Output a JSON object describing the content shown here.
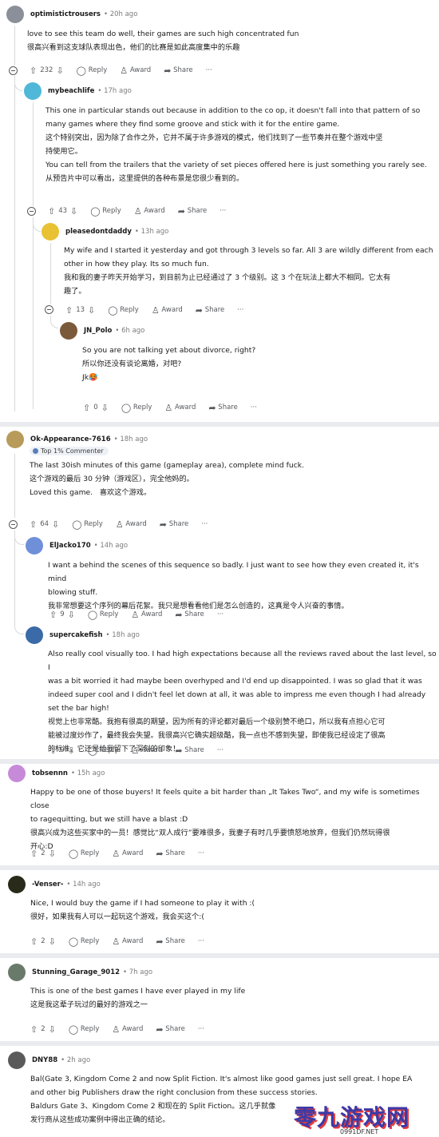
{
  "comments": [
    {
      "user": "optimistictrousers",
      "time": "20h ago",
      "lines": [
        "love to see this team do well, their games are such high concentrated fun",
        "很高兴看到这支球队表现出色，他们的比赛是如此高度集中的乐趣"
      ],
      "votes": "232",
      "avatar_color": "#8a8f99"
    },
    {
      "user": "mybeachlife",
      "time": "17h ago",
      "lines": [
        "This one in particular stands out because in addition to the co op, it doesn't fall into that pattern of so",
        "many games where they find some groove and stick with it for the entire game.",
        "这个特别突出，因为除了合作之外，它并不属于许多游戏的模式，他们找到了一些节奏并在整个游戏中坚",
        "持使用它。",
        "",
        "You can tell from the trailers that the variety of set pieces offered here is just something you rarely see.",
        "从预告片中可以看出，这里提供的各种布景是您很少看到的。"
      ],
      "votes": "43",
      "avatar_color": "#4fb8d8"
    },
    {
      "user": "pleasedontdaddy",
      "time": "13h ago",
      "lines": [
        "My wife and I started it yesterday and got through 3 levels so far. All 3 are wildly different from each",
        "other in how they play. Its so much fun.",
        "我和我的妻子昨天开始学习，到目前为止已经通过了 3 个级别。这 3 个在玩法上都大不相同。它太有",
        "趣了。"
      ],
      "votes": "13",
      "avatar_color": "#e8c233"
    },
    {
      "user": "JN_Polo",
      "time": "6h ago",
      "lines": [
        "So you are not talking yet about divorce, right?",
        "所以你还没有谈论离婚，对吧?",
        "",
        "Jk🥵"
      ],
      "votes": "0",
      "avatar_color": "#7a5a3a"
    },
    {
      "user": "Ok-Appearance-7616",
      "time": "18h ago",
      "badge": "Top 1% Commenter",
      "lines": [
        "The last 30ish minutes of this game (gameplay area), complete mind fuck.",
        "这个游戏的最后 30 分钟（游戏区），完全他妈的。",
        "",
        "Loved this game.   喜欢这个游戏。"
      ],
      "votes": "64",
      "avatar_color": "#b89a5a"
    },
    {
      "user": "ElJacko170",
      "time": "14h ago",
      "lines": [
        "I want a behind the scenes of this sequence so badly. I just want to see how they even created it, it's mind",
        "blowing stuff.",
        "我非常想要这个序列的幕后花絮。我只是想看看他们是怎么创造的，这真是令人兴奋的事情。"
      ],
      "votes": "9",
      "avatar_color": "#6f8fd8"
    },
    {
      "user": "supercakefish",
      "time": "18h ago",
      "lines": [
        "Also really cool visually too. I had high expectations because all the reviews raved about the last level, so I",
        "was a bit worried it had maybe been overhyped and I'd end up disappointed. I was so glad that it was",
        "indeed super cool and I didn't feel let down at all, it was able to impress me even though I had already",
        "set the bar high!",
        "视觉上也非常酷。我抱有很高的期望，因为所有的评论都对最后一个级别赞不绝口，所以我有点担心它可",
        "能被过度炒作了，最终我会失望。我很高兴它确实超级酷，我一点也不感到失望，即使我已经设定了很高",
        "的标准，它还是给我留下了深刻的印象！"
      ],
      "votes": "9",
      "avatar_color": "#3a6aa8"
    },
    {
      "user": "tobsennn",
      "time": "15h ago",
      "lines": [
        "Happy to be one of those buyers! It feels quite a bit harder than „It Takes Two“, and my wife is sometimes close",
        "to ragequitting, but we still have a blast :D",
        "很高兴成为这些买家中的一员！感觉比“双人成行”要难很多，我妻子有时几乎要愤怒地放弃，但我们仍然玩得很",
        "开心:D"
      ],
      "votes": "2",
      "avatar_color": "#c78ad8"
    },
    {
      "user": "-Venser-",
      "time": "14h ago",
      "lines": [
        "Nice, I would buy the game if I had someone to play it with :(",
        "很好，如果我有人可以一起玩这个游戏，我会买这个:("
      ],
      "votes": "2",
      "avatar_color": "#2a2a1a"
    },
    {
      "user": "Stunning_Garage_9012",
      "time": "7h ago",
      "lines": [
        "This is one of the best games I have ever played in my life",
        "这是我这辈子玩过的最好的游戏之一"
      ],
      "votes": "2",
      "avatar_color": "#6a7a6a"
    },
    {
      "user": "DNY88",
      "time": "2h ago",
      "lines": [
        "Bal(Gate 3, Kingdom Come 2 and now Split Fiction. It's almost like good games just sell great. I hope EA",
        "and other big Publishers draw the right conclusion from these success stories.",
        "Baldurs Gate 3、Kingdom Come 2 和现在的 Split Fiction。这几乎就像",
        "发行商从这些成功案例中得出正确的结论。"
      ],
      "votes": "",
      "avatar_color": "#5a5a5a"
    }
  ],
  "labels": {
    "reply": "Reply",
    "award": "Award",
    "share": "Share",
    "more": "···"
  },
  "watermark": {
    "title": "零九游戏网",
    "sub": "0991DF.NET"
  }
}
